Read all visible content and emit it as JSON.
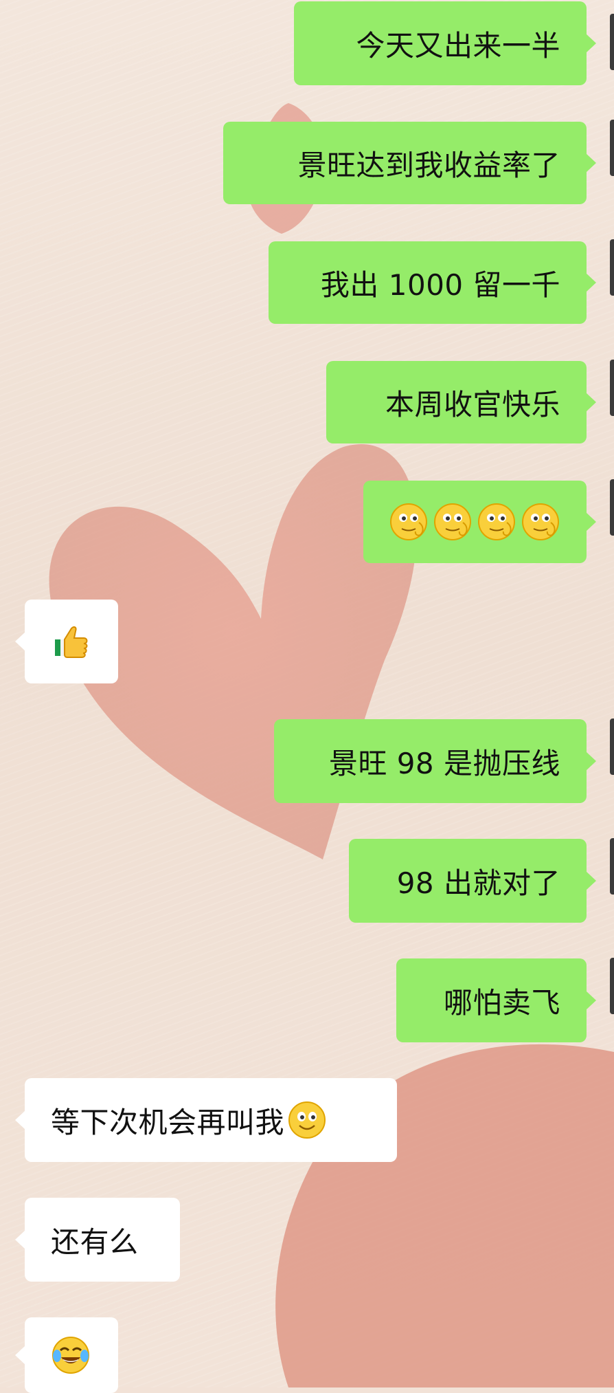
{
  "chat": {
    "messages": [
      {
        "side": "out",
        "text": "今天又出来一半"
      },
      {
        "side": "out",
        "text": "景旺达到我收益率了"
      },
      {
        "side": "out",
        "text": "我出 1000 留一千"
      },
      {
        "side": "out",
        "text": "本周收官快乐"
      },
      {
        "side": "out",
        "emojis": [
          "thinking-face-emoji",
          "thinking-face-emoji",
          "thinking-face-emoji",
          "thinking-face-emoji"
        ]
      },
      {
        "side": "in",
        "emojis": [
          "thumbs-up-emoji"
        ]
      },
      {
        "side": "out",
        "text": "景旺 98 是抛压线"
      },
      {
        "side": "out",
        "text": "98 出就对了"
      },
      {
        "side": "out",
        "text": "哪怕卖飞"
      },
      {
        "side": "in",
        "text": "等下次机会再叫我",
        "emojis": [
          "smiling-face-emoji"
        ]
      },
      {
        "side": "in",
        "text": "还有么"
      },
      {
        "side": "in",
        "emojis": [
          "tears-of-joy-emoji"
        ]
      }
    ]
  },
  "colors": {
    "outgoing_bubble": "#95ec69",
    "incoming_bubble": "#ffffff",
    "wallpaper": "#f2e2d7",
    "heart": "#e4a090"
  }
}
